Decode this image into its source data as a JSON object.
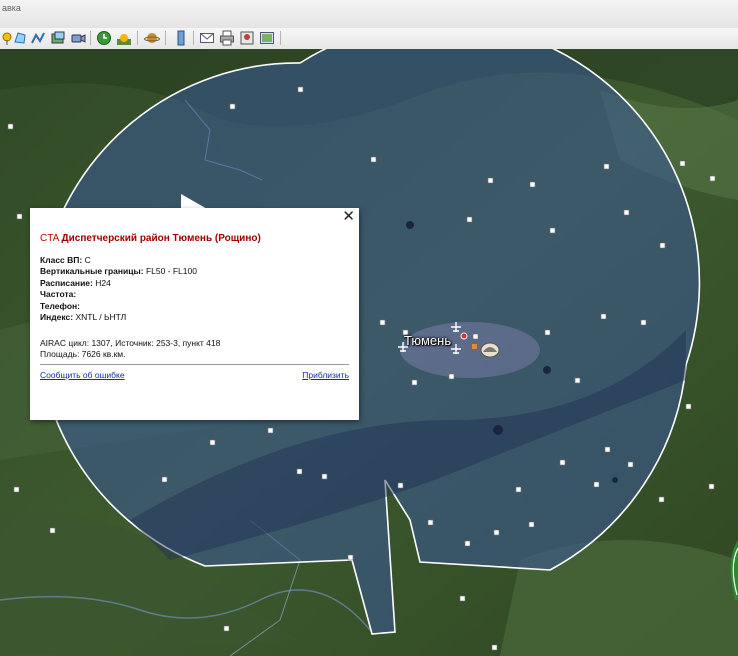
{
  "menubar": {
    "partial_text": "авка"
  },
  "toolbar": {
    "buttons": [
      {
        "icon": "add-placemark-icon"
      },
      {
        "icon": "add-polygon-icon"
      },
      {
        "icon": "add-path-icon"
      },
      {
        "icon": "add-overlay-icon"
      },
      {
        "icon": "record-tour-icon"
      },
      {
        "icon": "historical-imagery-icon"
      },
      {
        "icon": "sun-icon"
      },
      {
        "icon": "planets-icon"
      },
      {
        "icon": "ruler-icon"
      },
      {
        "icon": "email-icon"
      },
      {
        "icon": "print-icon"
      },
      {
        "icon": "save-image-icon"
      },
      {
        "icon": "view-maps-icon"
      }
    ]
  },
  "map": {
    "city_label": "Тюмень"
  },
  "popup": {
    "type_label": "CTA",
    "name": "Диспетчерский район Тюмень (Рощино)",
    "fields": [
      {
        "label": "Класс ВП:",
        "value": "C"
      },
      {
        "label": "Вертикальные границы:",
        "value": "FL50 - FL100"
      },
      {
        "label": "Расписание:",
        "value": "H24"
      },
      {
        "label": "Частота:",
        "value": ""
      },
      {
        "label": "Телефон:",
        "value": ""
      },
      {
        "label": "Индекс:",
        "value": "XNTL / ЬНТЛ"
      }
    ],
    "airac_line": "AIRAC цикл: 1307, Источник: 253-3, пункт 418",
    "area_line": "Площадь: 7626 кв.км.",
    "report_error_link": "Сообщить об ошибке",
    "zoom_link": "Приблизить",
    "close_symbol": "✕"
  },
  "colors": {
    "zone_fill": "#3a5a9a",
    "zone_border": "#ffffff",
    "title_red": "#c00000",
    "link_blue": "#0b2fa8"
  }
}
